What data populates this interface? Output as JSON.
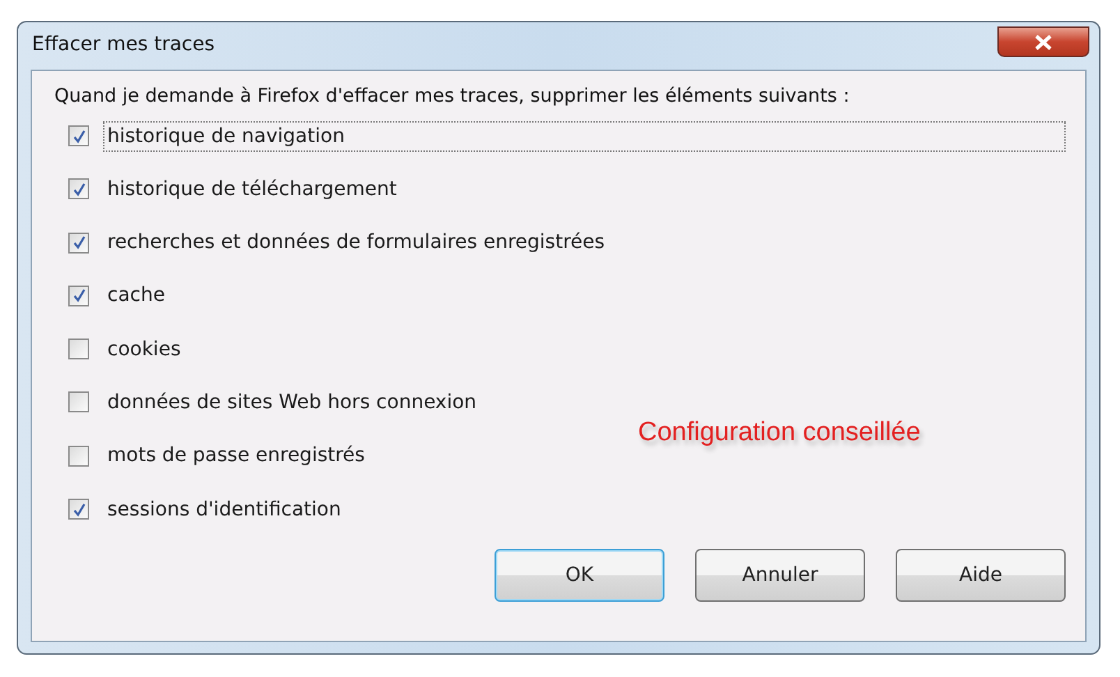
{
  "window": {
    "title": "Effacer mes traces"
  },
  "instruction": "Quand je demande à Firefox d'effacer mes traces, supprimer les éléments suivants :",
  "items": [
    {
      "label": "historique de navigation",
      "checked": true,
      "focused": true
    },
    {
      "label": "historique de téléchargement",
      "checked": true,
      "focused": false
    },
    {
      "label": "recherches et données de formulaires enregistrées",
      "checked": true,
      "focused": false
    },
    {
      "label": "cache",
      "checked": true,
      "focused": false
    },
    {
      "label": "cookies",
      "checked": false,
      "focused": false
    },
    {
      "label": "données de sites Web hors connexion",
      "checked": false,
      "focused": false
    },
    {
      "label": "mots de passe enregistrés",
      "checked": false,
      "focused": false
    },
    {
      "label": "sessions d'identification",
      "checked": true,
      "focused": false
    }
  ],
  "annotation": "Configuration conseillée",
  "buttons": [
    {
      "label": "OK",
      "default": true
    },
    {
      "label": "Annuler",
      "default": false
    },
    {
      "label": "Aide",
      "default": false
    }
  ]
}
